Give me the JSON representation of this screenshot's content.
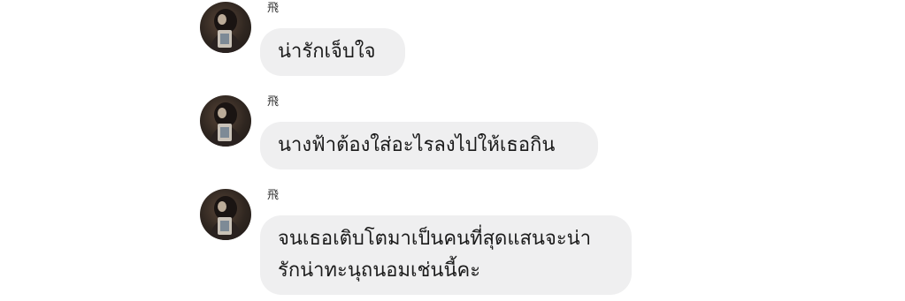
{
  "conversation": {
    "messages": [
      {
        "sender": "飛",
        "lines": [
          "น่ารักเจ็บใจ"
        ]
      },
      {
        "sender": "飛",
        "lines": [
          "นางฟ้าต้องใส่อะไรลงไปให้เธอกิน"
        ]
      },
      {
        "sender": "飛",
        "lines": [
          "จนเธอเติบโตมาเป็นคนที่สุดแสนจะน่า",
          "รักน่าทะนุถนอมเช่นนี้คะ"
        ]
      }
    ]
  },
  "colors": {
    "background": "#ffffff",
    "bubble": "#efeff0",
    "text": "#1b1b1b"
  },
  "icons": {
    "avatar": "user-avatar-photo"
  }
}
